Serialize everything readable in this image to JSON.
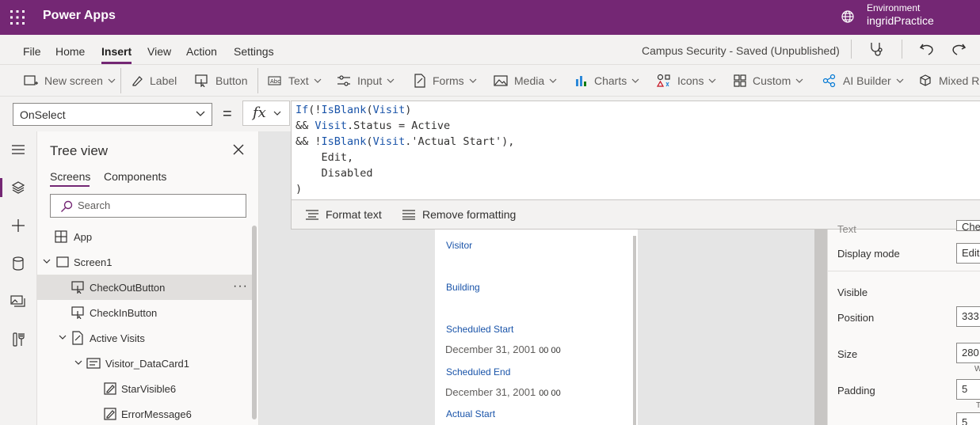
{
  "header": {
    "app_name": "Power Apps",
    "environment_label": "Environment",
    "environment_name": "ingridPractice"
  },
  "menu": {
    "items": [
      "File",
      "Home",
      "Insert",
      "View",
      "Action",
      "Settings"
    ],
    "active": "Insert",
    "app_status": "Campus Security - Saved (Unpublished)"
  },
  "ribbon": {
    "new_screen": "New screen",
    "label": "Label",
    "button": "Button",
    "text": "Text",
    "input": "Input",
    "forms": "Forms",
    "media": "Media",
    "charts": "Charts",
    "icons": "Icons",
    "custom": "Custom",
    "ai_builder": "AI Builder",
    "mixed_reality": "Mixed Re"
  },
  "formula_bar": {
    "property": "OnSelect",
    "equals": "=",
    "fx": "fx",
    "format_text": "Format text",
    "remove_formatting": "Remove formatting"
  },
  "tree_view": {
    "title": "Tree view",
    "tabs": [
      "Screens",
      "Components"
    ],
    "active_tab": "Screens",
    "search_placeholder": "Search",
    "nodes": [
      {
        "label": "App",
        "icon": "app-icon"
      },
      {
        "label": "Screen1",
        "icon": "screen-icon"
      },
      {
        "label": "CheckOutButton",
        "icon": "button-icon",
        "selected": true
      },
      {
        "label": "CheckInButton",
        "icon": "button-icon"
      },
      {
        "label": "Active Visits",
        "icon": "form-icon"
      },
      {
        "label": "Visitor_DataCard1",
        "icon": "datacard-icon"
      },
      {
        "label": "StarVisible6",
        "icon": "edit-icon"
      },
      {
        "label": "ErrorMessage6",
        "icon": "edit-icon"
      }
    ],
    "more": "···"
  },
  "canvas_form": {
    "fields": [
      {
        "label": "Visitor",
        "value": ""
      },
      {
        "label": "Building",
        "value": ""
      },
      {
        "label": "Scheduled Start",
        "value": "December 31, 2001",
        "time": "00  00"
      },
      {
        "label": "Scheduled End",
        "value": "December 31, 2001",
        "time": "00  00"
      },
      {
        "label": "Actual Start",
        "value": ""
      }
    ]
  },
  "properties": {
    "text_label": "Text",
    "text_value": "Chec",
    "display_mode_label": "Display mode",
    "display_mode_value": "Edit",
    "visible_label": "Visible",
    "position_label": "Position",
    "position_value": "333",
    "size_label": "Size",
    "size_value": "280",
    "size_sub": "W",
    "padding_label": "Padding",
    "padding_value": "5",
    "padding_sub": "T",
    "padding_value2": "5"
  }
}
